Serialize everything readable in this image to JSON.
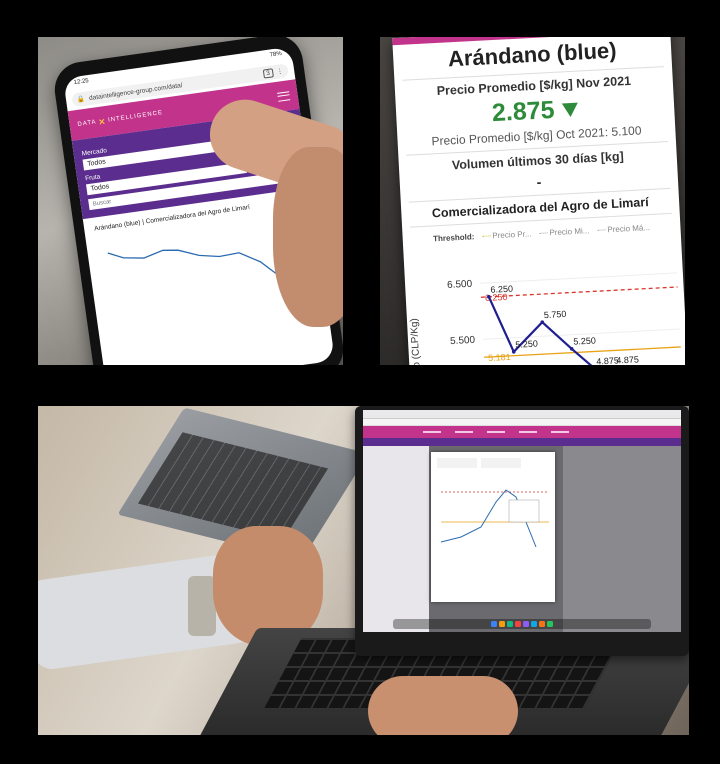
{
  "phone": {
    "time": "12:25",
    "battery": "78%",
    "url": "dataintelligence-group.com/data/",
    "tab_count": "3",
    "logo_left": "DATA",
    "logo_right": "INTELLIGENCE",
    "filter_market_label": "Mercado",
    "filter_market_value": "Todos",
    "filter_fruit_label": "Fruta",
    "filter_fruit_value": "Todos",
    "search_placeholder": "Buscar",
    "card_title": "Arándano (blue) | Comercializadora del Agro de Limarí",
    "colors": {
      "magenta": "#c2348c",
      "purple": "#5b2d8e",
      "line": "#2b6cb0"
    }
  },
  "price_card": {
    "title": "Arándano (blue)",
    "price_label": "Precio Promedio [$/kg] Nov 2021",
    "price_value": "2.875",
    "trend": "down",
    "previous_price": "Precio Promedio [$/kg] Oct 2021: 5.100",
    "volume_label": "Volumen últimos 30 días [kg]",
    "volume_value": "-",
    "company": "Comercializadora del Agro de Limarí",
    "legend_title": "Threshold:",
    "legend_items": [
      "Precio Pr...",
      "Precio Mi...",
      "Precio Má..."
    ],
    "y_axis_label": "dio (CLP/Kg)",
    "colors": {
      "price": "#2e8b3a",
      "accent": "#c2348c",
      "line": "#1f1f8f",
      "red": "#d9342b",
      "orange": "#e8a317"
    }
  },
  "chart_data": {
    "type": "line",
    "yticks": [
      "6.500",
      "5.500"
    ],
    "points": [
      {
        "label": "6.250",
        "value": 6.25
      },
      {
        "label": "5.250",
        "value": 5.25
      },
      {
        "label": "5.750",
        "value": 5.75
      },
      {
        "label": "5.250",
        "value": 5.25
      },
      {
        "label": "4.875",
        "value": 4.875
      },
      {
        "label": "4.875",
        "value": 4.875
      }
    ],
    "thresholds": [
      {
        "label": "6.250",
        "value": 6.25,
        "color": "#d9342b",
        "style": "dashed"
      },
      {
        "label": "5.181",
        "value": 5.181,
        "color": "#e8a317",
        "style": "solid"
      }
    ]
  }
}
